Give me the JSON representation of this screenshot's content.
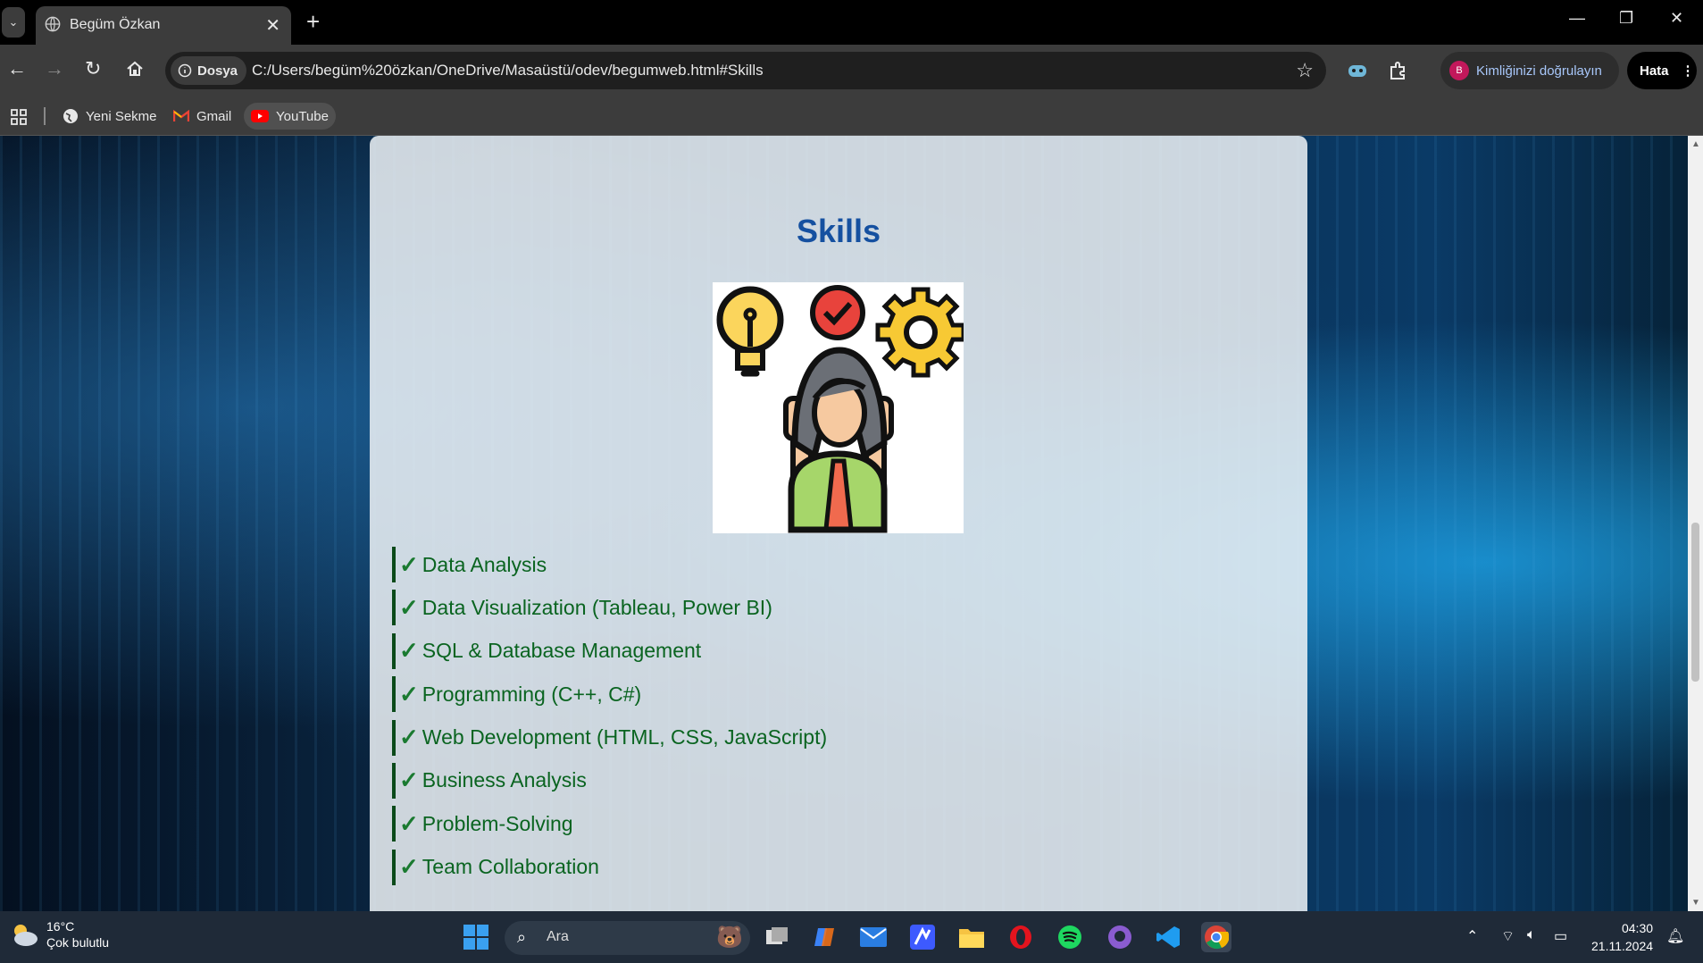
{
  "browser": {
    "tab_title": "Begüm Özkan",
    "address_chip": "Dosya",
    "url": "C:/Users/begüm%20özkan/OneDrive/Masaüstü/odev/begumweb.html#Skills",
    "profile_label": "Kimliğinizi doğrulayın",
    "profile_initial": "B",
    "error_label": "Hata",
    "bookmarks": [
      "Yeni Sekme",
      "Gmail",
      "YouTube"
    ]
  },
  "page": {
    "heading": "Skills",
    "skills": [
      "Data Analysis",
      "Data Visualization (Tableau, Power BI)",
      "SQL & Database Management",
      "Programming (C++, C#)",
      "Web Development (HTML, CSS, JavaScript)",
      "Business Analysis",
      "Problem-Solving",
      "Team Collaboration"
    ],
    "check_glyph": "✓"
  },
  "taskbar": {
    "temperature": "16°C",
    "weather": "Çok bulutlu",
    "search_label": "Ara",
    "time": "04:30",
    "date": "21.11.2024"
  },
  "colors": {
    "heading": "#1550a0",
    "skill_text": "#0a6420",
    "chrome_bg": "#3c3c3c"
  }
}
